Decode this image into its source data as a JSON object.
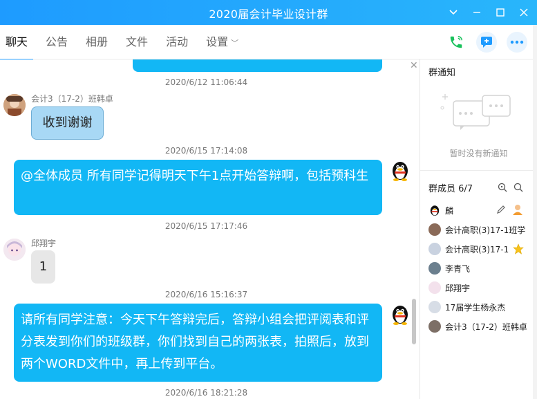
{
  "window": {
    "title": "2020届会计毕业设计群",
    "controls": [
      "chevron-down-icon",
      "minimize-icon",
      "maximize-icon",
      "close-icon"
    ]
  },
  "tabs": [
    {
      "label": "聊天",
      "active": true
    },
    {
      "label": "公告"
    },
    {
      "label": "相册"
    },
    {
      "label": "文件"
    },
    {
      "label": "活动"
    },
    {
      "label": "设置"
    }
  ],
  "chat": {
    "messages": [
      {
        "time": "2020/6/12 11:06:44"
      },
      {
        "time": "",
        "sender": "会计3（17-2）班韩卓",
        "text": "收到谢谢"
      },
      {
        "time": "2020/6/15 17:14:08",
        "text": "@全体成员 所有同学记得明天下午1点开始答辩啊，包括预科生"
      },
      {
        "time": "2020/6/15 17:17:46",
        "sender": "邱翔宇",
        "text": "1"
      },
      {
        "time": "2020/6/16 15:16:37",
        "text": "请所有同学注意：今天下午答辩完后，答辩小组会把评阅表和评分表发到你们的班级群，你们找到自己的两张表，拍照后，放到两个WORD文件中，再上传到平台。"
      },
      {
        "time": "2020/6/16 18:21:28"
      }
    ]
  },
  "panel": {
    "notice_title": "群通知",
    "notice_empty": "暂时没有新通知",
    "members_title": "群成员 6/7",
    "members": [
      {
        "name": "麟"
      },
      {
        "name": "会计高职(3)17-1班学"
      },
      {
        "name": "会计高职(3)17-1"
      },
      {
        "name": "李青飞"
      },
      {
        "name": "邱翔宇"
      },
      {
        "name": "17届学生杨永杰"
      },
      {
        "name": "会计3（17-2）班韩卓"
      }
    ]
  },
  "colors": {
    "accent": "#1e9bff",
    "bubble_me": "#12b7f5",
    "bubble_other": "#a8d8f5"
  }
}
